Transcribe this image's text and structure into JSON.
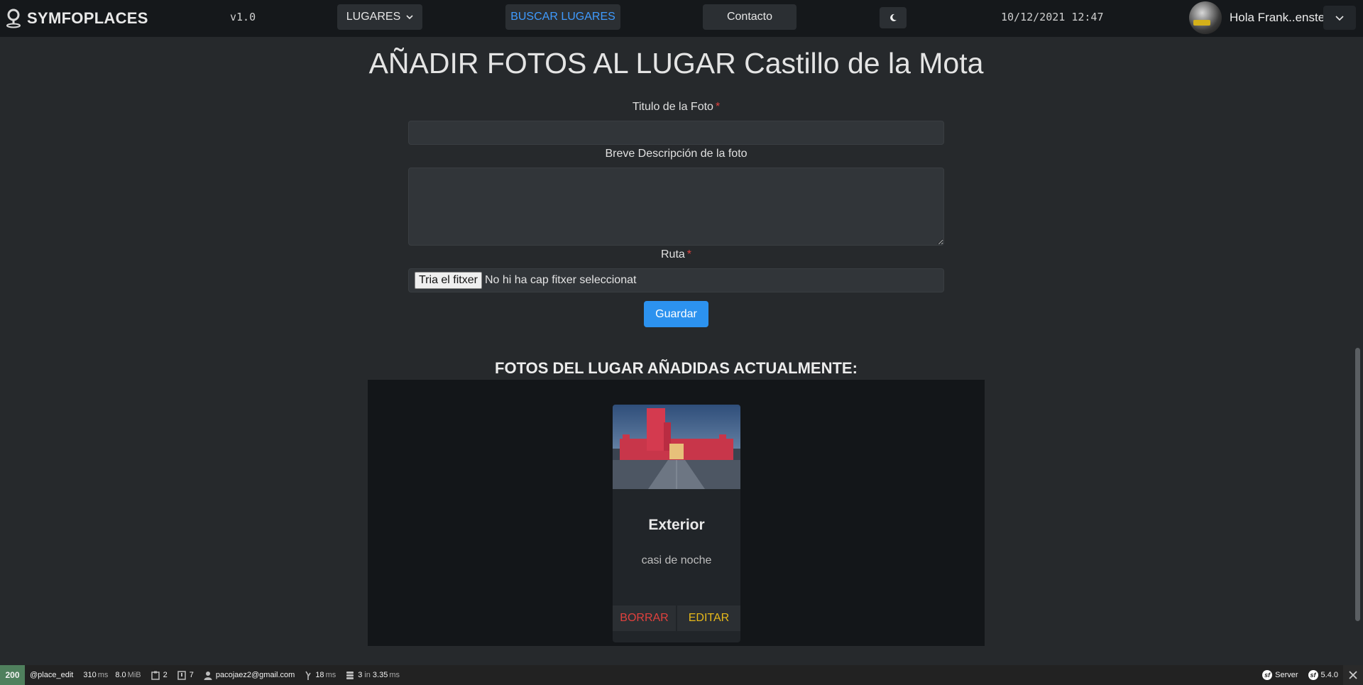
{
  "navbar": {
    "brand": "SYMFOPLACES",
    "version": "v1.0",
    "lugares_label": "LUGARES",
    "buscar_label": "BUSCAR LUGARES",
    "contacto_label": "Contacto",
    "datetime": "10/12/2021 12:47",
    "user_greeting": "Hola Frank..enstein"
  },
  "form": {
    "title": "AÑADIR FOTOS AL LUGAR Castillo de la Mota",
    "titulo_label": "Titulo de la Foto",
    "descripcion_label": "Breve Descripción de la foto",
    "ruta_label": "Ruta",
    "required_mark": "*",
    "file_button": "Tria el fitxer",
    "file_status": "No hi ha cap fitxer seleccionat",
    "submit_label": "Guardar"
  },
  "photos": {
    "section_title": "FOTOS DEL LUGAR AÑADIDAS ACTUALMENTE:",
    "items": [
      {
        "title": "Exterior",
        "description": "casi de noche",
        "delete_label": "BORRAR",
        "edit_label": "EDITAR"
      }
    ]
  },
  "debug_toolbar": {
    "status": "200",
    "route": "@place_edit",
    "time_value": "310",
    "time_unit": "ms",
    "memory_value": "8.0",
    "memory_unit": "MiB",
    "forms_count": "2",
    "validator_count": "7",
    "user": "pacojaez2@gmail.com",
    "twig_value": "18",
    "twig_unit": "ms",
    "db_queries": "3",
    "db_in": "in",
    "db_time": "3.35",
    "db_unit": "ms",
    "server_label": "Server",
    "symfony_version": "5.4.0"
  },
  "colors": {
    "accent_blue": "#2c92ef",
    "link_blue": "#3f9bff",
    "danger": "#e0413d",
    "warning": "#e7b91a",
    "status_ok": "#4f805d"
  }
}
